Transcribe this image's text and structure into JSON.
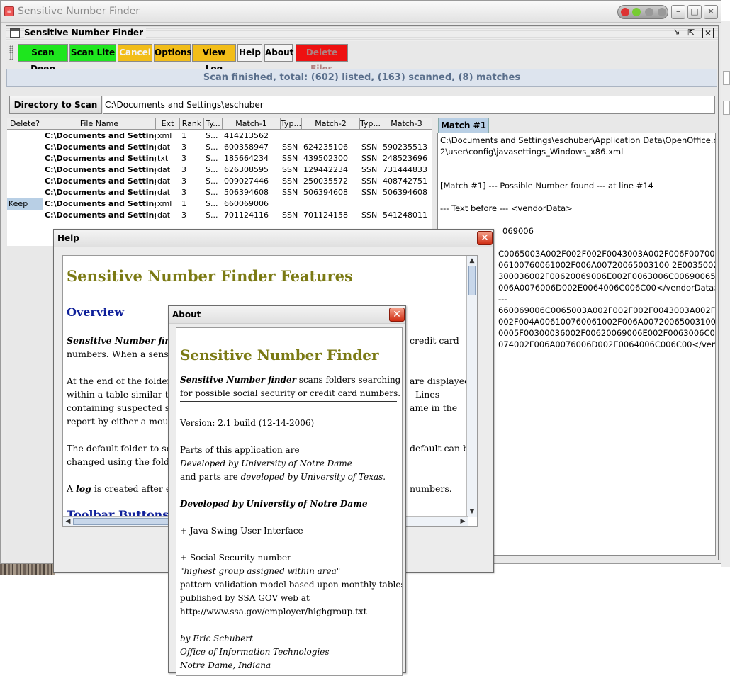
{
  "os_window": {
    "title": "Sensitive Number Finder"
  },
  "frame": {
    "title": "Sensitive Number Finder"
  },
  "toolbar": {
    "buttons": [
      {
        "label": "Scan Deep"
      },
      {
        "label": "Scan Lite"
      },
      {
        "label": "Cancel"
      },
      {
        "label": "Options"
      },
      {
        "label": "View Log"
      },
      {
        "label": "Help"
      },
      {
        "label": "About"
      },
      {
        "label": "Delete Files"
      }
    ]
  },
  "status": {
    "text": "Scan finished, total: (602) listed, (163) scanned, (8) matches"
  },
  "directory": {
    "button_label": "Directory to Scan",
    "value": "C:\\Documents and Settings\\eschuber"
  },
  "table": {
    "headers": [
      "Delete?",
      "File Name",
      "Ext",
      "Rank",
      "Ty...",
      "Match-1",
      "Typ...",
      "Match-2",
      "Typ...",
      "Match-3"
    ],
    "rows": [
      {
        "delete": "",
        "file": "C:\\Documents and Setting...",
        "ext": "xml",
        "rank": "1",
        "type1": "S...",
        "match1": "414213562",
        "type2": "",
        "match2": "",
        "type3": "",
        "match3": ""
      },
      {
        "delete": "",
        "file": "C:\\Documents and Setting...",
        "ext": "dat",
        "rank": "3",
        "type1": "S...",
        "match1": "600358947",
        "type2": "SSN",
        "match2": "624235106",
        "type3": "SSN",
        "match3": "590235513"
      },
      {
        "delete": "",
        "file": "C:\\Documents and Setting...",
        "ext": "txt",
        "rank": "3",
        "type1": "S...",
        "match1": "185664234",
        "type2": "SSN",
        "match2": "439502300",
        "type3": "SSN",
        "match3": "248523696"
      },
      {
        "delete": "",
        "file": "C:\\Documents and Setting...",
        "ext": "dat",
        "rank": "3",
        "type1": "S...",
        "match1": "626308595",
        "type2": "SSN",
        "match2": "129442234",
        "type3": "SSN",
        "match3": "731444833"
      },
      {
        "delete": "",
        "file": "C:\\Documents and Setting...",
        "ext": "dat",
        "rank": "3",
        "type1": "S...",
        "match1": "009027446",
        "type2": "SSN",
        "match2": "250035572",
        "type3": "SSN",
        "match3": "408742751"
      },
      {
        "delete": "",
        "file": "C:\\Documents and Setting...",
        "ext": "dat",
        "rank": "3",
        "type1": "S...",
        "match1": "506394608",
        "type2": "SSN",
        "match2": "506394608",
        "type3": "SSN",
        "match3": "506394608"
      },
      {
        "delete": "Keep",
        "file": "C:\\Documents and Setting...",
        "ext": "xml",
        "rank": "1",
        "type1": "S...",
        "match1": "660069006",
        "type2": "",
        "match2": "",
        "type3": "",
        "match3": ""
      },
      {
        "delete": "",
        "file": "C:\\Documents and Setting...",
        "ext": "dat",
        "rank": "3",
        "type1": "S...",
        "match1": "701124116",
        "type2": "SSN",
        "match2": "701124158",
        "type3": "SSN",
        "match3": "541248011"
      }
    ]
  },
  "match_pane": {
    "tab_label": "Match #1",
    "lines": [
      "C:\\Documents and Settings\\eschuber\\Application Data\\OpenOffice.org",
      "2\\user\\config\\javasettings_Windows_x86.xml",
      "",
      "",
      "[Match #1] --- Possible Number found --- at line #14",
      "",
      "--- Text before --- <vendorData>",
      "",
      "069006",
      "",
      "C0065003A002F002F002F0043003A002F006F00700",
      "06100760061002F006A00720065003100 2E0035002",
      "300036002F00620069006E002F0063006C006900650",
      "006A0076006D002E0064006C006C00</vendorData>",
      "---",
      "660069006C0065003A002F002F002F0043003A002F0",
      "002F004A006100760061002F006A007200650031002E",
      "0005F00300036002F00620069006E002F0063006C00",
      "074002F006A0076006D002E0064006C006C00</vend"
    ]
  },
  "help_dialog": {
    "title": "Help",
    "heading": "Sensitive Number Finder Features",
    "overview_heading": "Overview",
    "p1_line1_lead": "Sensitive Number finder",
    "p1_line1_tail": "credit card",
    "p1_line2": "numbers. When a sensitiv",
    "p2_line1_left": "At the end of the folder s",
    "p2_line1_right": "are displayed",
    "p2_line2_left": "within a table similar to a",
    "p2_line2_right": "Lines",
    "p2_line3_left": "containing suspected sen",
    "p2_line3_right": "ame in the",
    "p2_line4_left": "report by either a mouse",
    "p3_line1_left": "The default folder to scan",
    "p3_line1_right": "default can be",
    "p3_line2_left": "changed using the folder",
    "p4_lead": "A",
    "p4_word": "log",
    "p4_left": "is created after eac",
    "p4_right": "numbers.",
    "toolbar_heading": "Toolbar Buttons"
  },
  "about_dialog": {
    "title": "About",
    "heading": "Sensitive Number Finder",
    "intro_lead": "Sensitive Number finder",
    "intro_rest": "scans folders searching files",
    "intro_line2": "for possible social security or credit card numbers.",
    "version": "Version: 2.1 build (12-14-2006)",
    "parts_line1": "Parts of this application are",
    "parts_line2": "Developed by University of Notre Dame",
    "parts_line3_a": "and parts are",
    "parts_line3_b": "developed by University of Texas.",
    "nd_heading": "Developed by University of Notre Dame",
    "swing": "+ Java Swing User Interface",
    "ssn_line1": "+ Social Security number",
    "ssn_line2": "\"highest group assigned within area\"",
    "ssn_line3": "pattern validation model based upon monthly tables",
    "ssn_line4": "published by SSA GOV web at",
    "ssn_line5": "http://www.ssa.gov/employer/highgroup.txt",
    "by": "by Eric Schubert",
    "office": "Office of Information Technologies",
    "place": "Notre Dame, Indiana"
  },
  "colors": {
    "green_button": "#1ee61e",
    "yellow_button": "#f2bd18",
    "red_button": "#ee1111",
    "status_text": "#5a6f8c",
    "help_heading": "#7b7a14",
    "help_subheading": "#0f209a",
    "keep_highlight": "#b8cfe5"
  }
}
